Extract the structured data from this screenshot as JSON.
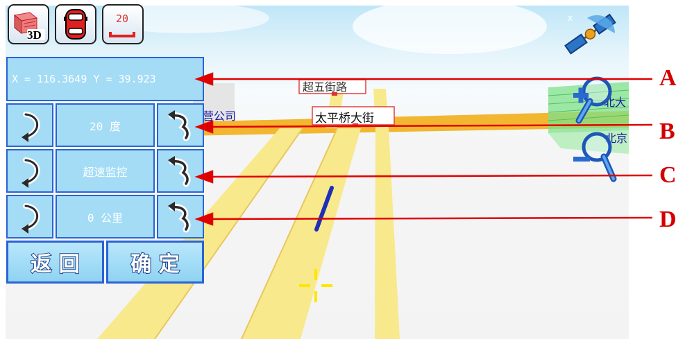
{
  "toolbar": {
    "btn_3d_label": "3D",
    "speed_label": "20"
  },
  "coords": {
    "text": "X = 116.3649  Y = 39.923"
  },
  "settings": [
    {
      "value": "20 度"
    },
    {
      "value": "超速监控"
    },
    {
      "value": "0 公里"
    }
  ],
  "actions": {
    "back_label": "返 回",
    "confirm_label": "确 定"
  },
  "map": {
    "label_road_top": "超五街路",
    "label_company": "经营公司",
    "label_street": "太平桥大街",
    "label_right_top": "北大",
    "label_right_bottom": "北京"
  },
  "callouts": [
    "A",
    "B",
    "C",
    "D"
  ],
  "colors": {
    "panel_fill": "#a4dcf6",
    "panel_border": "#2a63d6",
    "road_fill": "#f8e98c",
    "road_main": "#f1b32d",
    "callout_red": "#e00000"
  }
}
